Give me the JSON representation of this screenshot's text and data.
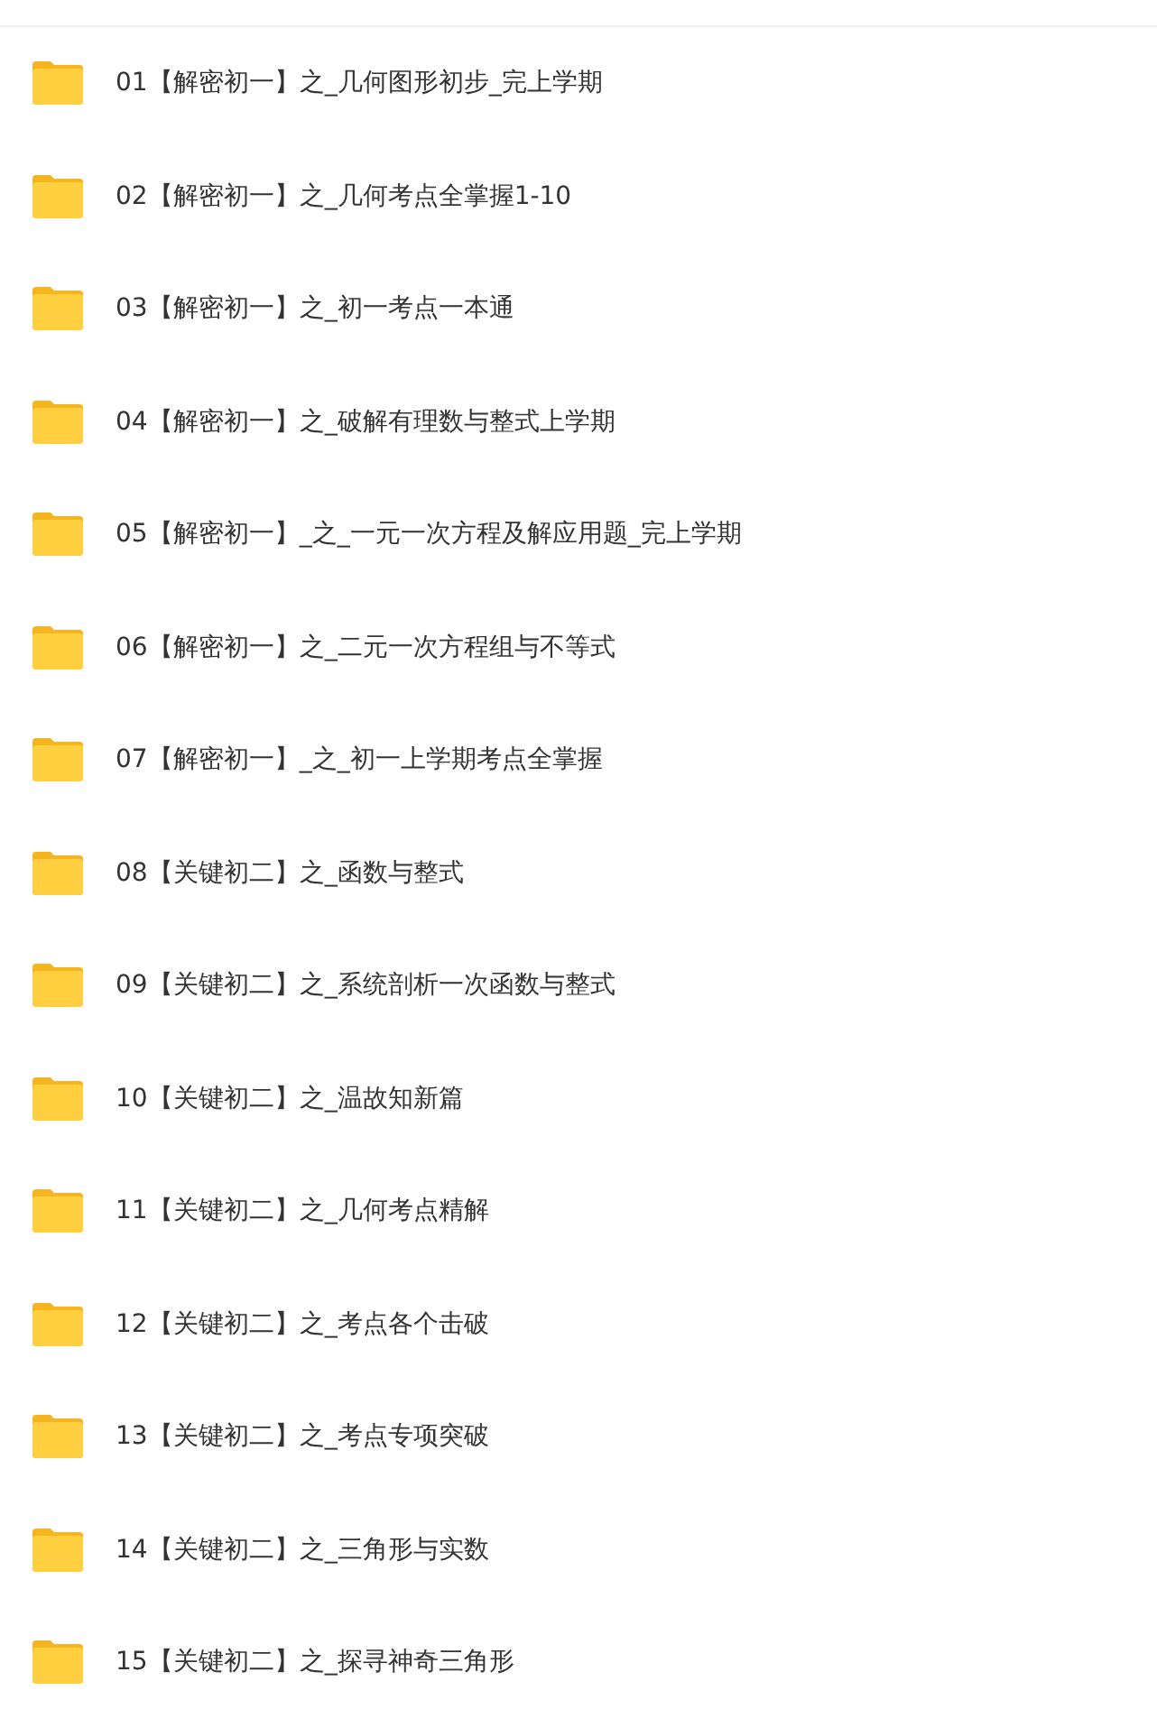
{
  "folders": [
    {
      "name": "01【解密初一】之_几何图形初步_完上学期"
    },
    {
      "name": "02【解密初一】之_几何考点全掌握1-10"
    },
    {
      "name": "03【解密初一】之_初一考点一本通"
    },
    {
      "name": "04【解密初一】之_破解有理数与整式上学期"
    },
    {
      "name": "05【解密初一】_之_一元一次方程及解应用题_完上学期"
    },
    {
      "name": "06【解密初一】之_二元一次方程组与不等式"
    },
    {
      "name": "07【解密初一】_之_初一上学期考点全掌握"
    },
    {
      "name": "08【关键初二】之_函数与整式"
    },
    {
      "name": "09【关键初二】之_系统剖析一次函数与整式"
    },
    {
      "name": "10【关键初二】之_温故知新篇"
    },
    {
      "name": "11【关键初二】之_几何考点精解"
    },
    {
      "name": "12【关键初二】之_考点各个击破"
    },
    {
      "name": "13【关键初二】之_考点专项突破"
    },
    {
      "name": "14【关键初二】之_三角形与实数"
    },
    {
      "name": "15【关键初二】之_探寻神奇三角形"
    }
  ]
}
